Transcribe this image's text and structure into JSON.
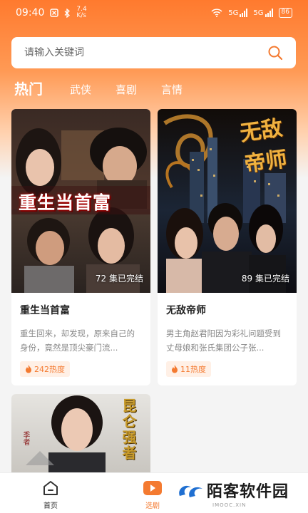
{
  "status_bar": {
    "time": "09:40",
    "net_speed_top": "7.4",
    "net_speed_bottom": "K/s",
    "sim1": "5G",
    "sim2": "5G",
    "battery": "86"
  },
  "search": {
    "placeholder": "请输入关键词"
  },
  "tabs": [
    {
      "label": "热门",
      "active": true
    },
    {
      "label": "武侠",
      "active": false
    },
    {
      "label": "喜剧",
      "active": false
    },
    {
      "label": "言情",
      "active": false
    }
  ],
  "cards": [
    {
      "poster_title": "重生当首富",
      "episodes": "72 集已完结",
      "title": "重生当首富",
      "desc": "重生回来，却发现，原来自己的身份，竟然是顶尖豪门流...",
      "heat": "242热度"
    },
    {
      "poster_title": "无敌帝师",
      "episodes": "89 集已完结",
      "title": "无敌帝师",
      "desc": "男主角赵君阳因为彩礼问题受到丈母娘和张氏集团公子张...",
      "heat": "11热度"
    },
    {
      "poster_title": "昆仑强者",
      "poster_stamp": "季者"
    }
  ],
  "bottom_nav": [
    {
      "label": "首页",
      "icon": "home-icon",
      "active": false
    },
    {
      "label": "选剧",
      "icon": "play-icon",
      "active": true
    }
  ],
  "watermark": {
    "text": "陌客软件园",
    "sub": "IMOOC.XIN"
  },
  "colors": {
    "accent": "#f47a30",
    "gradient_top": "#ff7a2e"
  }
}
